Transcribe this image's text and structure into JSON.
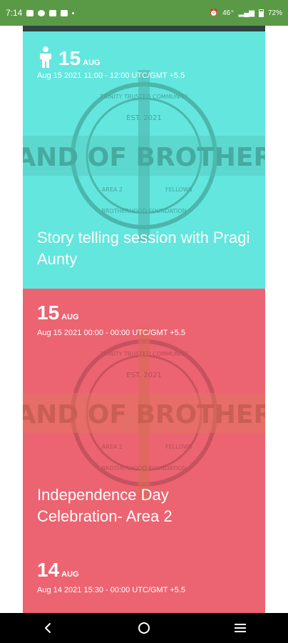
{
  "status_bar": {
    "time": "7:14",
    "signal": "46⁺",
    "battery": "72%"
  },
  "events": [
    {
      "day": "15",
      "month": "AUG",
      "time": "Aug 15 2021 11:00 - 12:00 UTC/GMT +5.5",
      "title": "Story telling session with Pragi Aunty",
      "color": "#63e6de",
      "icon": "person-icon"
    },
    {
      "day": "15",
      "month": "AUG",
      "time": "Aug 15 2021 00:00 - 00:00 UTC/GMT +5.5",
      "title": "Independence Day Celebration- Area 2",
      "color": "#ec6471"
    },
    {
      "day": "14",
      "month": "AUG",
      "time": "Aug 14 2021 15:30 - 00:00 UTC/GMT +5.5",
      "title": "",
      "color": "#ec6471"
    }
  ],
  "logo": {
    "top_text": "TRINITY TRUSTED COMMUNITY",
    "est": "EST. 2021",
    "banner": "BAND OF BROTHERS",
    "mid_left": "AREA 2",
    "mid_right": "FELLOWS",
    "bottom_text": "BROTHERHOOD FOUNDATION"
  },
  "nav": {
    "back_icon": "back-icon",
    "home_icon": "home-icon",
    "menu_icon": "menu-icon"
  }
}
